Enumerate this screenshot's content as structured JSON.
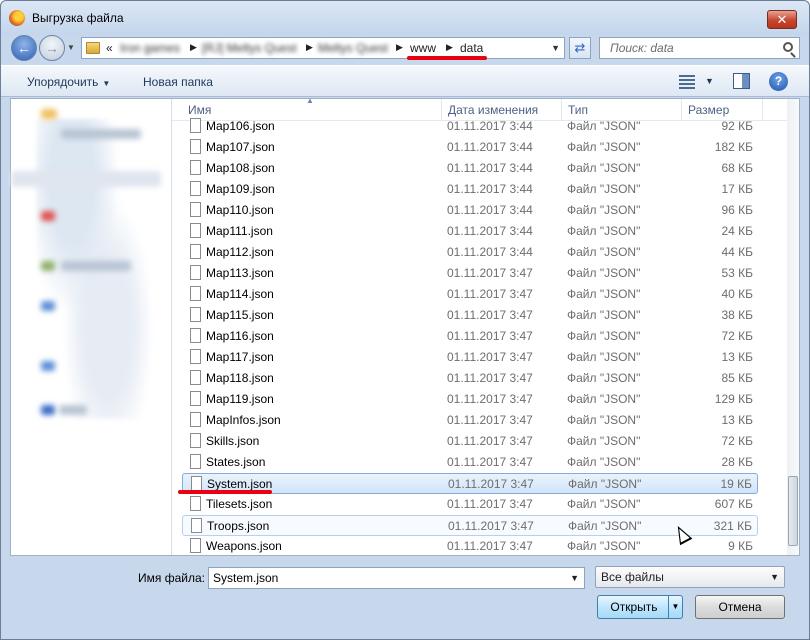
{
  "window": {
    "title": "Выгрузка файла",
    "close_glyph": "✕"
  },
  "address": {
    "overflow": "«",
    "blurred_crumbs": [
      "Iron games",
      "[RJ] Meltys Quest",
      "Meltys Quest"
    ],
    "crumbs": [
      "www",
      "data"
    ],
    "search_placeholder": "Поиск: data"
  },
  "toolbar": {
    "organize_label": "Упорядочить",
    "new_folder_label": "Новая папка",
    "help_glyph": "?"
  },
  "columns": {
    "name": "Имя",
    "date": "Дата изменения",
    "type": "Тип",
    "size": "Размер"
  },
  "files": [
    {
      "name": "Map106.json",
      "date": "01.11.2017 3:44",
      "type": "Файл \"JSON\"",
      "size": "92 КБ"
    },
    {
      "name": "Map107.json",
      "date": "01.11.2017 3:44",
      "type": "Файл \"JSON\"",
      "size": "182 КБ"
    },
    {
      "name": "Map108.json",
      "date": "01.11.2017 3:44",
      "type": "Файл \"JSON\"",
      "size": "68 КБ"
    },
    {
      "name": "Map109.json",
      "date": "01.11.2017 3:44",
      "type": "Файл \"JSON\"",
      "size": "17 КБ"
    },
    {
      "name": "Map110.json",
      "date": "01.11.2017 3:44",
      "type": "Файл \"JSON\"",
      "size": "96 КБ"
    },
    {
      "name": "Map111.json",
      "date": "01.11.2017 3:44",
      "type": "Файл \"JSON\"",
      "size": "24 КБ"
    },
    {
      "name": "Map112.json",
      "date": "01.11.2017 3:44",
      "type": "Файл \"JSON\"",
      "size": "44 КБ"
    },
    {
      "name": "Map113.json",
      "date": "01.11.2017 3:47",
      "type": "Файл \"JSON\"",
      "size": "53 КБ"
    },
    {
      "name": "Map114.json",
      "date": "01.11.2017 3:47",
      "type": "Файл \"JSON\"",
      "size": "40 КБ"
    },
    {
      "name": "Map115.json",
      "date": "01.11.2017 3:47",
      "type": "Файл \"JSON\"",
      "size": "38 КБ"
    },
    {
      "name": "Map116.json",
      "date": "01.11.2017 3:47",
      "type": "Файл \"JSON\"",
      "size": "72 КБ"
    },
    {
      "name": "Map117.json",
      "date": "01.11.2017 3:47",
      "type": "Файл \"JSON\"",
      "size": "13 КБ"
    },
    {
      "name": "Map118.json",
      "date": "01.11.2017 3:47",
      "type": "Файл \"JSON\"",
      "size": "85 КБ"
    },
    {
      "name": "Map119.json",
      "date": "01.11.2017 3:47",
      "type": "Файл \"JSON\"",
      "size": "129 КБ"
    },
    {
      "name": "MapInfos.json",
      "date": "01.11.2017 3:47",
      "type": "Файл \"JSON\"",
      "size": "13 КБ"
    },
    {
      "name": "Skills.json",
      "date": "01.11.2017 3:47",
      "type": "Файл \"JSON\"",
      "size": "72 КБ"
    },
    {
      "name": "States.json",
      "date": "01.11.2017 3:47",
      "type": "Файл \"JSON\"",
      "size": "28 КБ"
    },
    {
      "name": "System.json",
      "date": "01.11.2017 3:47",
      "type": "Файл \"JSON\"",
      "size": "19 КБ",
      "state": "selected"
    },
    {
      "name": "Tilesets.json",
      "date": "01.11.2017 3:47",
      "type": "Файл \"JSON\"",
      "size": "607 КБ"
    },
    {
      "name": "Troops.json",
      "date": "01.11.2017 3:47",
      "type": "Файл \"JSON\"",
      "size": "321 КБ",
      "state": "hover"
    },
    {
      "name": "Weapons.json",
      "date": "01.11.2017 3:47",
      "type": "Файл \"JSON\"",
      "size": "9 КБ"
    }
  ],
  "footer": {
    "filename_label": "Имя файла:",
    "filename_value": "System.json",
    "filter_value": "Все файлы",
    "open_label": "Открыть",
    "cancel_label": "Отмена"
  },
  "colors": {
    "annotation_red": "#e60012",
    "selection_blue": "#84acdd"
  }
}
